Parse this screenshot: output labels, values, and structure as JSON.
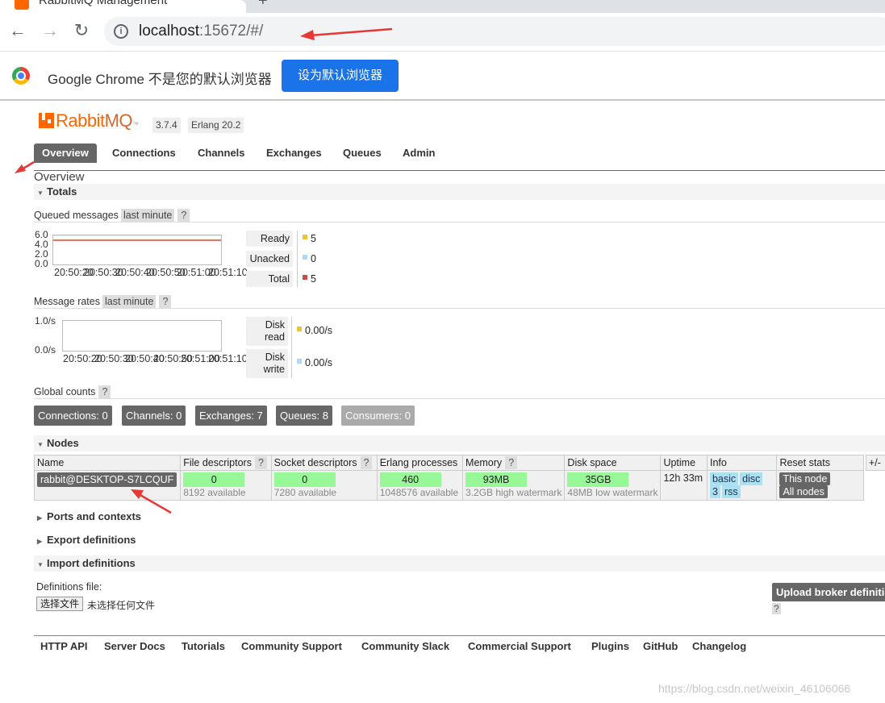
{
  "browser": {
    "tab_title": "RabbitMQ Management",
    "new_tab": "+",
    "url_host": "localhost",
    "url_rest": ":15672/#/",
    "infobar_text": "Google Chrome 不是您的默认浏览器",
    "set_default_label": "设为默认浏览器",
    "back": "←",
    "forward": "→",
    "reload": "↻",
    "info": "i"
  },
  "app": {
    "logo_rabbit": "Rabbit",
    "logo_mq": "MQ",
    "logo_tm": "™",
    "version": "3.7.4",
    "erlang": "Erlang 20.2"
  },
  "nav": {
    "overview": "Overview",
    "connections": "Connections",
    "channels": "Channels",
    "exchanges": "Exchanges",
    "queues": "Queues",
    "admin": "Admin"
  },
  "page_title": "Overview",
  "totals": {
    "heading": "Totals",
    "queued": {
      "label": "Queued messages",
      "range": "last minute",
      "help": "?",
      "yticks": [
        "6.0",
        "4.0",
        "2.0",
        "0.0"
      ],
      "xticks": [
        "20:50:20",
        "20:50:30",
        "20:50:40",
        "20:50:50",
        "20:51:00",
        "20:51:10"
      ],
      "legend": [
        {
          "label": "Ready",
          "value": "5",
          "color": "#edc240"
        },
        {
          "label": "Unacked",
          "value": "0",
          "color": "#afd8f8"
        },
        {
          "label": "Total",
          "value": "5",
          "color": "#cb4b4b"
        }
      ]
    },
    "rates": {
      "label": "Message rates",
      "range": "last minute",
      "help": "?",
      "yticks": [
        "1.0/s",
        "0.0/s"
      ],
      "xticks": [
        "20:50:20",
        "20:50:30",
        "20:50:40",
        "20:50:50",
        "20:51:00",
        "20:51:10"
      ],
      "legend": [
        {
          "label_line1": "Disk",
          "label_line2": "read",
          "value": "0.00/s",
          "color": "#edc240"
        },
        {
          "label_line1": "Disk",
          "label_line2": "write",
          "value": "0.00/s",
          "color": "#afd8f8"
        }
      ]
    },
    "global_counts": {
      "label": "Global counts",
      "help": "?",
      "items": [
        "Connections: 0",
        "Channels: 0",
        "Exchanges: 7",
        "Queues: 8",
        "Consumers: 0"
      ]
    }
  },
  "nodes": {
    "heading": "Nodes",
    "columns": {
      "name": "Name",
      "fd": "File descriptors",
      "sd": "Socket descriptors",
      "ep": "Erlang processes",
      "mem": "Memory",
      "disk": "Disk space",
      "uptime": "Uptime",
      "info": "Info",
      "reset": "Reset stats"
    },
    "help": "?",
    "plusminus": "+/-",
    "row": {
      "name": "rabbit@DESKTOP-S7LCQUF",
      "fd_value": "0",
      "fd_avail": "8192 available",
      "sd_value": "0",
      "sd_avail": "7280 available",
      "ep_value": "460",
      "ep_avail": "1048576 available",
      "mem_value": "93MB",
      "mem_avail": "3.2GB high watermark",
      "disk_value": "35GB",
      "disk_avail": "48MB low watermark",
      "uptime": "12h 33m",
      "info_tags": [
        "basic",
        "disc",
        "3",
        "rss"
      ],
      "reset_this": "This node",
      "reset_all": "All nodes"
    }
  },
  "sections": {
    "ports": "Ports and contexts",
    "export": "Export definitions",
    "import": "Import definitions"
  },
  "import": {
    "file_label": "Definitions file:",
    "choose_file": "选择文件",
    "no_file": "未选择任何文件",
    "upload": "Upload broker definitions",
    "help": "?"
  },
  "footer": [
    "HTTP API",
    "Server Docs",
    "Tutorials",
    "Community Support",
    "Community Slack",
    "Commercial Support",
    "Plugins",
    "GitHub",
    "Changelog"
  ],
  "watermark": "https://blog.csdn.net/weixin_46106066",
  "colors": {
    "accent": "#ff6600",
    "annotation_arrow": "#e53935",
    "chrome_button": "#1a73e8"
  }
}
